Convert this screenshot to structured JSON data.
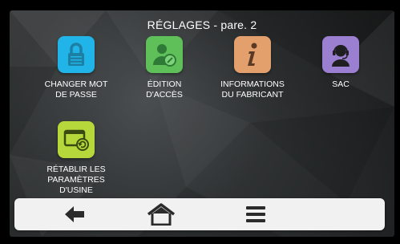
{
  "header": {
    "title": "RÉGLAGES - pare. 2"
  },
  "tiles": [
    {
      "label": "CHANGER MOT\nDE PASSE",
      "icon": "lock-icon",
      "color": "#20b4e8"
    },
    {
      "label": "ÉDITION\nD'ACCÈS",
      "icon": "user-access-icon",
      "color": "#5fbf59"
    },
    {
      "label": "INFORMATIONS\nDU FABRICANT",
      "icon": "info-icon",
      "color": "#e3a06d"
    },
    {
      "label": "SAC",
      "icon": "headset-icon",
      "color": "#9b7fd1"
    },
    {
      "label": "RÉTABLIR LES\nPARAMÈTRES\nD'USINE",
      "icon": "factory-reset-icon",
      "color": "#b7d83a"
    }
  ],
  "navbar": {
    "back_icon": "back-arrow-icon",
    "home_icon": "home-icon",
    "menu_icon": "hamburger-menu-icon"
  }
}
